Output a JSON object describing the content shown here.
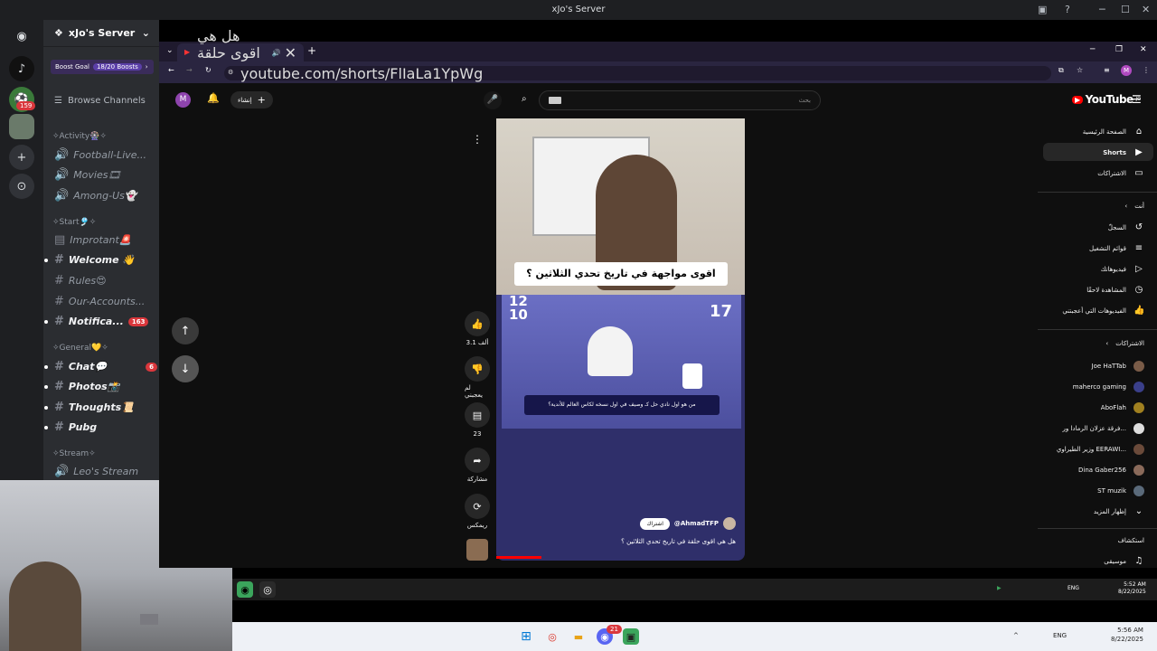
{
  "window": {
    "title": "xJo's Server",
    "minimize": "─",
    "maximize": "☐",
    "close": "✕"
  },
  "server": {
    "name": "xJo's Server",
    "boost_label": "Boost Goal",
    "boost_count": "18/20 Boosts",
    "browse": "Browse Channels",
    "rail_badge": "159"
  },
  "categories": [
    {
      "label": "✧Activity🎡✧"
    },
    {
      "label": "✧Start🎐✧"
    },
    {
      "label": "✧General💛✧"
    },
    {
      "label": "✧Stream✧"
    }
  ],
  "channels": [
    {
      "label": "Football-Live..."
    },
    {
      "label": "Movies🎞"
    },
    {
      "label": "Among-Us👻"
    },
    {
      "label": "Improtant🚨"
    },
    {
      "label": "Welcome 👋"
    },
    {
      "label": "Rules😍"
    },
    {
      "label": "Our-Accounts..."
    },
    {
      "label": "Notifica...",
      "badge": "163"
    },
    {
      "label": "Chat💬",
      "badge": "6"
    },
    {
      "label": "Photos📸"
    },
    {
      "label": "Thoughts📜"
    },
    {
      "label": "Pubg"
    },
    {
      "label": "Leo's Stream"
    }
  ],
  "browser": {
    "tab_title": "هل هي اقوى حلقة في تاريخ",
    "url": "youtube.com/shorts/FlIaLa1YpWg",
    "new_tab": "+"
  },
  "youtube": {
    "logo": "YouTube",
    "logo_sup": "JO",
    "create": "إنشاء",
    "avatar": "M",
    "search_placeholder": "بحث",
    "nav": [
      {
        "label": "الصفحة الرئيسية",
        "icon": "⌂"
      },
      {
        "label": "Shorts",
        "icon": "▶"
      },
      {
        "label": "الاشتراكات",
        "icon": "▭"
      }
    ],
    "you_header": "أنت",
    "you_items": [
      {
        "label": "السجلّ",
        "icon": "↺"
      },
      {
        "label": "قوائم التشغيل",
        "icon": "≡"
      },
      {
        "label": "فيديوهاتك",
        "icon": "▷"
      },
      {
        "label": "المشاهدة لاحقًا",
        "icon": "◷"
      },
      {
        "label": "الفيديوهات التي أعجبتني",
        "icon": "👍"
      }
    ],
    "subs_header": "الاشتراكات",
    "subs": [
      {
        "label": "Joe HaTTab"
      },
      {
        "label": "maherco gaming"
      },
      {
        "label": "AboFlah"
      },
      {
        "label": "فرقة عزلان الرمادا ور..."
      },
      {
        "label": "وزير الطيراوي EERAWI..."
      },
      {
        "label": "Dina Gaber256"
      },
      {
        "label": "ST muzik"
      }
    ],
    "show_more": "إظهار المزيد",
    "explore_header": "استكشاف",
    "explore_item": "موسيقى",
    "short": {
      "title": "اقوى مواجهة في تاريخ تحدي الثلاثين ؟",
      "score_left": "12\n10",
      "score_right": "17",
      "caption": "من هو اول نادي حل كـ وصيف في اول نسخه لكاس العالم للأندية؟",
      "channel": "@AhmadTFP",
      "subscribe": "اشتراك",
      "desc": "هل هي اقوى حلقة في تاريخ تحدي الثلاثين ؟",
      "likes": "3.1 ألف",
      "dislike": "لم يعجبني",
      "comments": "23",
      "share": "مشاركة",
      "remix": "ريمكس"
    }
  },
  "taskbar_inner": {
    "lang": "ENG",
    "time": "5:52 AM",
    "date": "8/22/2025"
  },
  "taskbar_outer": {
    "lang": "ENG",
    "time": "5:56 AM",
    "date": "8/22/2025",
    "discord_badge": "21"
  }
}
